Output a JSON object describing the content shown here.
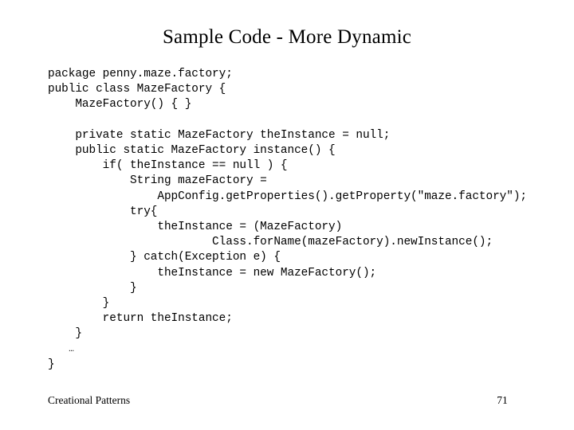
{
  "slide": {
    "title": "Sample Code - More Dynamic",
    "background_color": "#ffffff",
    "text_color": "#000000"
  },
  "code": {
    "language": "java",
    "lines": [
      "package penny.maze.factory;",
      "public class MazeFactory {",
      "    MazeFactory() { }",
      "",
      "    private static MazeFactory theInstance = null;",
      "    public static MazeFactory instance() {",
      "        if( theInstance == null ) {",
      "            String mazeFactory =",
      "                AppConfig.getProperties().getProperty(\"maze.factory\");",
      "            try{",
      "                theInstance = (MazeFactory)",
      "                        Class.forName(mazeFactory).newInstance();",
      "            } catch(Exception e) {",
      "                theInstance = new MazeFactory();",
      "            }",
      "        }",
      "        return theInstance;",
      "    }",
      "    …",
      "}"
    ]
  },
  "footer": {
    "section_label": "Creational Patterns",
    "page_number": "71"
  }
}
